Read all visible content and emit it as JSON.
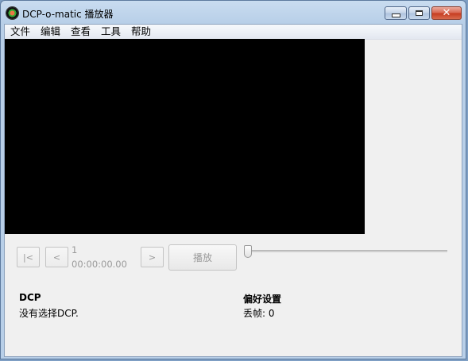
{
  "window": {
    "title": "DCP-o-matic 播放器",
    "close_glyph": "✕"
  },
  "menu": {
    "items": [
      {
        "label": "文件"
      },
      {
        "label": "编辑"
      },
      {
        "label": "查看"
      },
      {
        "label": "工具"
      },
      {
        "label": "帮助"
      }
    ]
  },
  "controls": {
    "go_start_label": "|<",
    "back_label": "<",
    "forward_label": ">",
    "frame": "1",
    "timecode": "00:00:00.00",
    "play_label": "播放",
    "position": 0
  },
  "info": {
    "dcp_heading": "DCP",
    "dcp_status": "没有选择DCP.",
    "prefs_heading": "偏好设置",
    "dropped_frames": "丢帧: 0"
  },
  "icons": {
    "app": "dcp-o-matic-app-icon",
    "minimize": "minimize-icon",
    "maximize": "maximize-icon",
    "close": "close-icon"
  }
}
